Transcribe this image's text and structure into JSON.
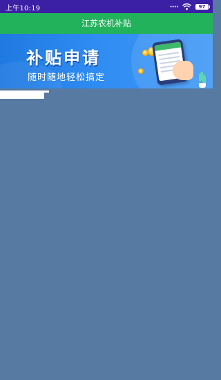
{
  "status_bar": {
    "time": "上午10:19",
    "signal_dots": "••••",
    "battery": "97"
  },
  "header": {
    "title": "江苏农机补贴"
  },
  "banner": {
    "title": "补贴申请",
    "subtitle": "随时随地轻松搞定"
  },
  "colors": {
    "status_bar": "#3b1fa5",
    "title_bar": "#23b25c",
    "banner": "#2f8cf2",
    "background": "#567aa2"
  }
}
